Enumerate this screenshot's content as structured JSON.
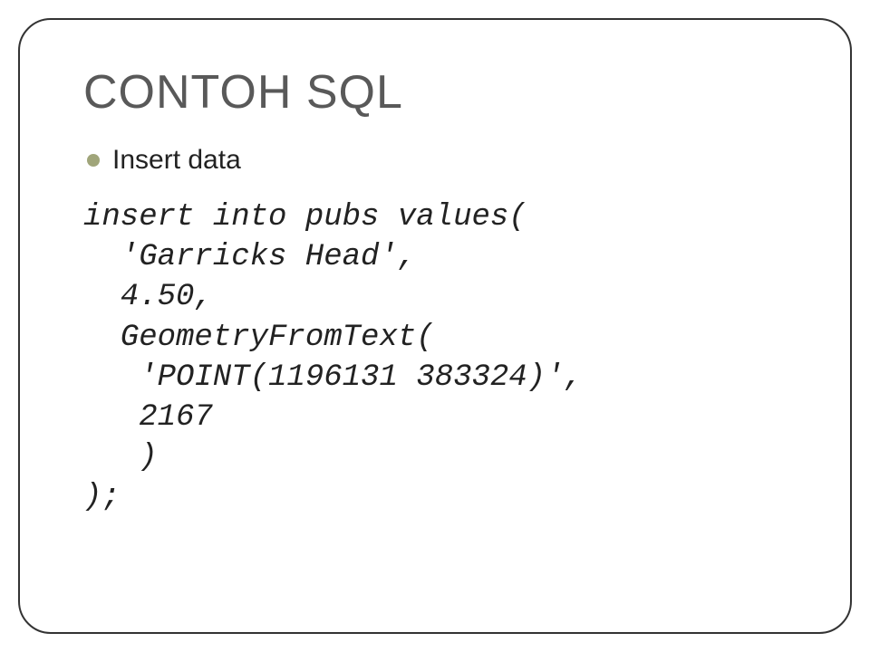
{
  "title": "CONTOH SQL",
  "bullet": "Insert data",
  "code": "insert into pubs values(\n  'Garricks Head',\n  4.50,\n  GeometryFromText(\n   'POINT(1196131 383324)',\n   2167\n   )\n);"
}
